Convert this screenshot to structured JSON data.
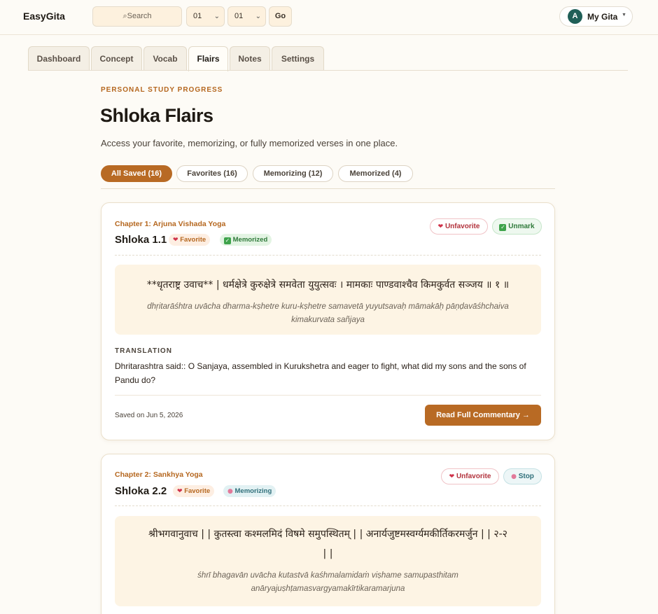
{
  "header": {
    "brand": "EasyGita",
    "search_placeholder": "⌕Search",
    "chapter_select": "01",
    "verse_select": "01",
    "go_label": "Go",
    "user_avatar": "A",
    "user_menu_label": "My Gita"
  },
  "tabs": [
    {
      "label": "Dashboard"
    },
    {
      "label": "Concept"
    },
    {
      "label": "Vocab"
    },
    {
      "label": "Flairs",
      "active": true
    },
    {
      "label": "Notes"
    },
    {
      "label": "Settings"
    }
  ],
  "page": {
    "kicker": "PERSONAL STUDY PROGRESS",
    "title": "Shloka Flairs",
    "subtitle": "Access your favorite, memorizing, or fully memorized verses in one place."
  },
  "filters": [
    {
      "label": "All Saved (16)",
      "active": true
    },
    {
      "label": "Favorites (16)"
    },
    {
      "label": "Memorizing (12)"
    },
    {
      "label": "Memorized (4)"
    }
  ],
  "cards": [
    {
      "chapter": "Chapter 1: Arjuna Vishada Yoga",
      "shloka": "Shloka 1.1",
      "badges": [
        "Favorite",
        "Memorized"
      ],
      "actions": [
        "Unfavorite",
        "Unmark"
      ],
      "devanagari": "**धृतराष्ट्र उवाच** | धर्मक्षेत्रे कुरुक्षेत्रे समवेता युयुत्सवः । मामकाः पाण्डवाश्चैव किमकुर्वत सञ्जय ॥ १ ॥",
      "transliteration": "dhṛitarāśhtra uvācha dharma-kṣhetre kuru-kṣhetre samavetā yuyutsavaḥ māmakāḥ pāṇḍavāśhchaiva kimakurvata sañjaya",
      "translation_label": "TRANSLATION",
      "translation": "Dhritarashtra said:: O Sanjaya, assembled in Kurukshetra and eager to fight, what did my sons and the sons of Pandu do?",
      "saved_on": "Saved on Jun 5, 2026",
      "read_label": "Read Full Commentary →"
    },
    {
      "chapter": "Chapter 2: Sankhya Yoga",
      "shloka": "Shloka 2.2",
      "badges": [
        "Favorite",
        "Memorizing"
      ],
      "actions": [
        "Unfavorite",
        "Stop"
      ],
      "devanagari_line1": "श्रीभगवानुवाच |  | कुतस्त्वा कश्मलमिदं विषमे समुपस्थितम् |  | अनार्यजुष्टमस्वर्ग्यमकीर्तिकरमर्जुन |  | २-२",
      "devanagari_line2": "| |",
      "transliteration": "śhrī bhagavān uvācha kutastvā kaśhmalamidaṁ viṣhame samupasthitam anāryajuṣhṭamasvargyamakīrtikaramarjuna"
    }
  ],
  "colors": {
    "accent": "#b86a24",
    "background": "#fdfbf6",
    "verse_bg": "#fdf4e4",
    "avatar": "#1f5f57"
  }
}
